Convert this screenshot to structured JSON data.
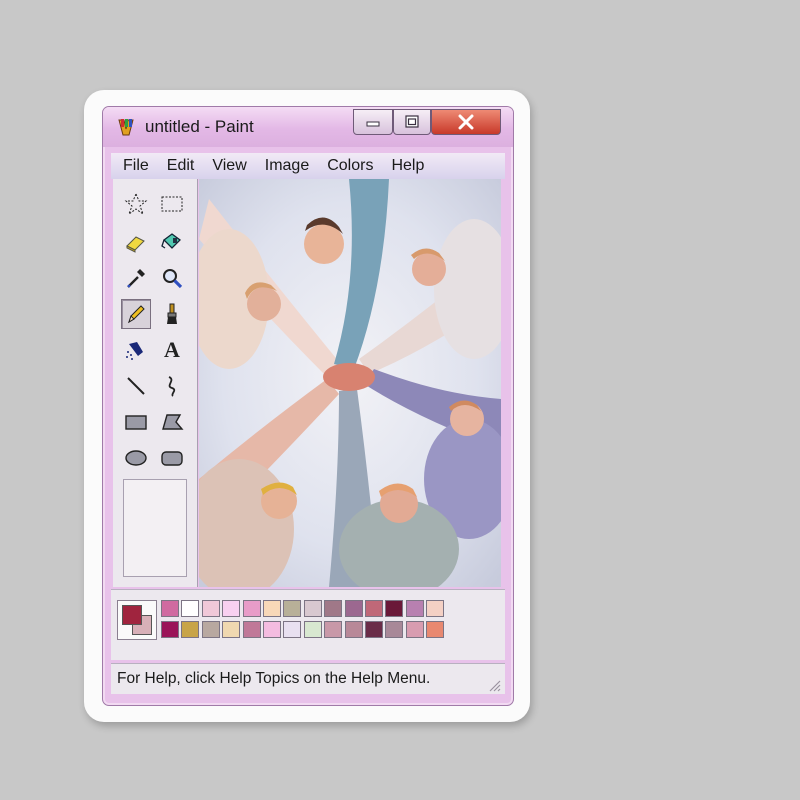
{
  "window": {
    "title": "untitled - Paint",
    "controls": {
      "minimize": "minimize-icon",
      "maximize": "maximize-icon",
      "close": "close-icon"
    }
  },
  "menu": {
    "items": [
      {
        "label": "File"
      },
      {
        "label": "Edit"
      },
      {
        "label": "View"
      },
      {
        "label": "Image"
      },
      {
        "label": "Colors"
      },
      {
        "label": "Help"
      }
    ]
  },
  "toolbox": {
    "tools": [
      {
        "icon": "free-form-select-icon"
      },
      {
        "icon": "rect-select-icon"
      },
      {
        "icon": "eraser-icon"
      },
      {
        "icon": "fill-bucket-icon"
      },
      {
        "icon": "color-picker-icon"
      },
      {
        "icon": "magnifier-icon"
      },
      {
        "icon": "pencil-icon",
        "selected": true
      },
      {
        "icon": "brush-icon"
      },
      {
        "icon": "airbrush-icon"
      },
      {
        "icon": "text-icon",
        "glyph": "A"
      },
      {
        "icon": "line-icon"
      },
      {
        "icon": "curve-icon"
      },
      {
        "icon": "rectangle-icon"
      },
      {
        "icon": "polygon-icon"
      },
      {
        "icon": "ellipse-icon"
      },
      {
        "icon": "rounded-rect-icon"
      }
    ]
  },
  "colors": {
    "foreground": "#a0243e",
    "background": "#d8b0b8",
    "palette": [
      "#d06aa0",
      "#ffffff",
      "#f0c8d8",
      "#f8d0f0",
      "#e89cc8",
      "#f8d8b8",
      "#b8b098",
      "#d8c8d0",
      "#a07888",
      "#9c6890",
      "#c06878",
      "#6a1838",
      "#b880b0",
      "#f4d0c4",
      "#9a1458",
      "#c8a448",
      "#b8a8a0",
      "#f0d8b0",
      "#c07898",
      "#f4bce0",
      "#e8e0f0",
      "#d8e8d0",
      "#c898a8",
      "#b88898",
      "#6a2c48",
      "#a88898",
      "#d89cb0",
      "#e88870"
    ]
  },
  "status": {
    "text": "For Help, click Help Topics on the Help Menu."
  }
}
